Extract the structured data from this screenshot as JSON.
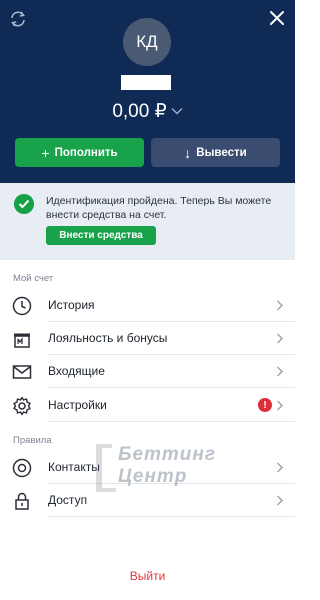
{
  "header": {
    "avatar_initials": "КД",
    "balance": "0,00 ₽",
    "deposit_label": "Пополнить",
    "withdraw_label": "Вывести",
    "refresh_icon": "refresh-icon",
    "close_icon": "close-icon"
  },
  "banner": {
    "text": "Идентификация пройдена. Теперь Вы можете внести средства на счет.",
    "button_label": "Внести средства"
  },
  "account": {
    "section_label": "Мой счет",
    "items": [
      {
        "label": "История",
        "icon": "clock-icon"
      },
      {
        "label": "Лояльность и бонусы",
        "icon": "gift-icon"
      },
      {
        "label": "Входящие",
        "icon": "envelope-icon"
      },
      {
        "label": "Настройки",
        "icon": "gear-icon",
        "alert": "!"
      }
    ]
  },
  "rules": {
    "section_label": "Правила",
    "items": [
      {
        "label": "Контакты",
        "icon": "lifebuoy-icon"
      },
      {
        "label": "Доступ",
        "icon": "lock-icon"
      }
    ]
  },
  "watermark": {
    "line1": "Беттинг",
    "line2": "Центр"
  },
  "logout_label": "Выйти",
  "colors": {
    "header_bg": "#102a56",
    "accent_green": "#18a34a",
    "withdraw_bg": "#3a4d70",
    "alert_red": "#e02d3c",
    "logout_red": "#e3343f"
  }
}
